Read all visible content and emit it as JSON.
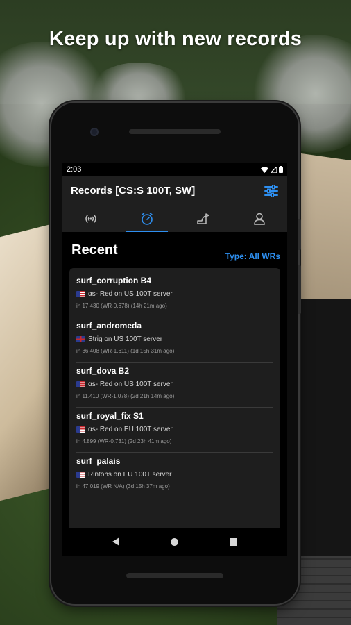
{
  "headline": "Keep up with new records",
  "status": {
    "time": "2:03"
  },
  "appbar": {
    "title": "Records [CS:S 100T, SW]",
    "tabs": [
      {
        "icon": "signal-icon",
        "active": false
      },
      {
        "icon": "stopwatch-icon",
        "active": true
      },
      {
        "icon": "map-icon",
        "active": false
      },
      {
        "icon": "person-icon",
        "active": false
      }
    ]
  },
  "section": {
    "title": "Recent",
    "filter_label": "Type: All WRs"
  },
  "records": [
    {
      "map": "surf_corruption B4",
      "flag": "us",
      "player_line": "αs- Red on US 100T server",
      "meta": "in 17.430 (WR-0.678) (14h 21m ago)"
    },
    {
      "map": "surf_andromeda",
      "flag": "uk",
      "player_line": "Strig on US 100T server",
      "meta": "in 36.408 (WR-1.611) (1d 15h 31m ago)"
    },
    {
      "map": "surf_dova B2",
      "flag": "us",
      "player_line": "αs- Red on US 100T server",
      "meta": "in 11.410 (WR-1.078) (2d 21h 14m ago)"
    },
    {
      "map": "surf_royal_fix S1",
      "flag": "us",
      "player_line": "αs- Red on EU 100T server",
      "meta": "in 4.899 (WR-0.731) (2d 23h 41m ago)"
    },
    {
      "map": "surf_palais",
      "flag": "us",
      "player_line": "Rintohs on EU 100T server",
      "meta": "in 47.019 (WR N/A) (3d 15h 37m ago)"
    }
  ],
  "colors": {
    "accent": "#2e8ff0",
    "card_bg": "#1e1e1e",
    "appbar_bg": "#1f1f1f"
  }
}
